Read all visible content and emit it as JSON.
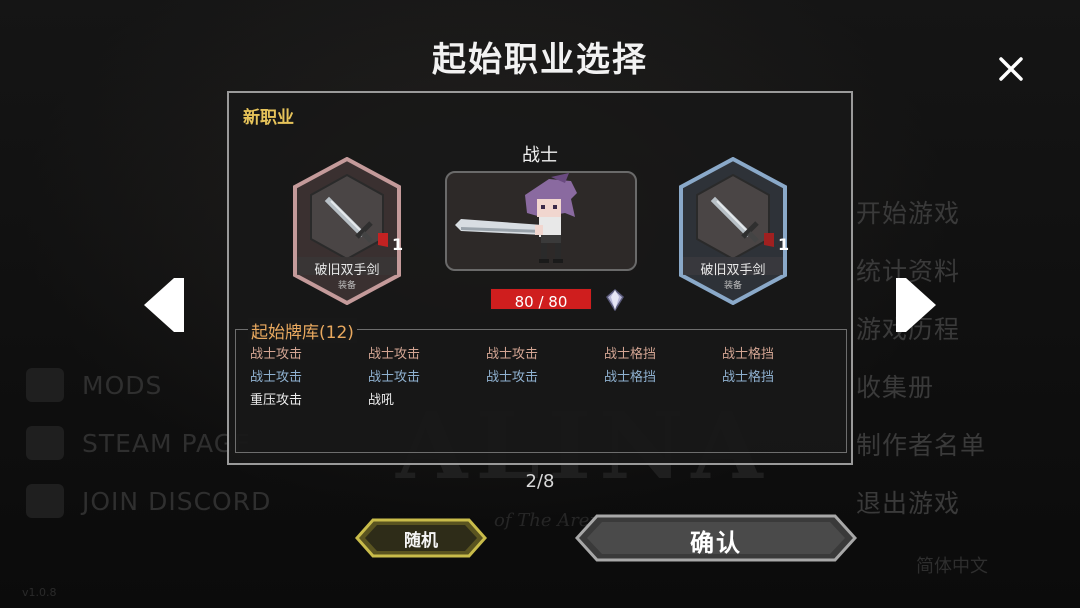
{
  "title": "起始职业选择",
  "panel": {
    "section_label": "新职业",
    "class_name": "战士",
    "left_equipment": {
      "name": "破旧双手剑",
      "type": "装备",
      "count": "1",
      "icon": "sword-icon",
      "frame_color": "#c49a9a"
    },
    "right_equipment": {
      "name": "破旧双手剑",
      "type": "装备",
      "count": "1",
      "icon": "sword-icon",
      "frame_color": "#8aa9c9"
    },
    "hp": {
      "text": "80 / 80",
      "current": 80,
      "max": 80,
      "color": "#cf1e1e"
    },
    "deck": {
      "label": "起始牌库(12)",
      "rows": [
        [
          {
            "name": "战士攻击",
            "color": "#d3a593"
          },
          {
            "name": "战士攻击",
            "color": "#d3a593"
          },
          {
            "name": "战士攻击",
            "color": "#d3a593"
          },
          {
            "name": "战士格挡",
            "color": "#d3a593"
          },
          {
            "name": "战士格挡",
            "color": "#d3a593"
          }
        ],
        [
          {
            "name": "战士攻击",
            "color": "#8fb1d0"
          },
          {
            "name": "战士攻击",
            "color": "#8fb1d0"
          },
          {
            "name": "战士攻击",
            "color": "#8fb1d0"
          },
          {
            "name": "战士格挡",
            "color": "#8fb1d0"
          },
          {
            "name": "战士格挡",
            "color": "#8fb1d0"
          }
        ],
        [
          {
            "name": "重压攻击",
            "color": "#ececec"
          },
          {
            "name": "战吼",
            "color": "#ececec"
          }
        ]
      ]
    }
  },
  "pager": "2/8",
  "buttons": {
    "random": "随机",
    "confirm": "确认"
  },
  "background_menu": {
    "right_items": [
      "开始游戏",
      "统计资料",
      "游戏历程",
      "收集册",
      "制作者名单",
      "退出游戏"
    ],
    "left_links": [
      "MODS",
      "STEAM PAGE",
      "JOIN DISCORD"
    ],
    "logo": "ALINA",
    "logo_sub": "of The Arena",
    "language": "简体中文",
    "version": "v1.0.8"
  },
  "colors": {
    "accent_gold": "#e6c35a",
    "deck_label": "#e9a95f",
    "panel_border": "#9a9a9a"
  }
}
